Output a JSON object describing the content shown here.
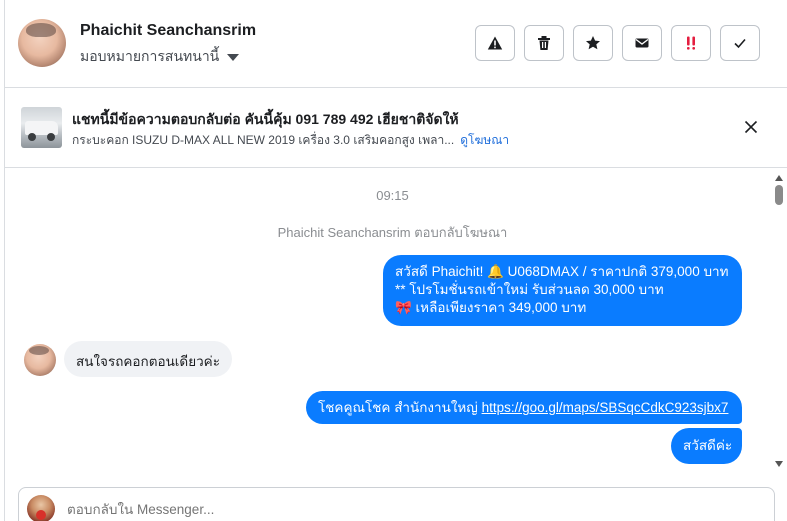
{
  "header": {
    "name": "Phaichit Seanchansrim",
    "assign_label": "มอบหมายการสนทนานี้",
    "actions": [
      {
        "name": "report-button",
        "icon": "warning-icon"
      },
      {
        "name": "delete-button",
        "icon": "trash-icon"
      },
      {
        "name": "star-button",
        "icon": "star-icon"
      },
      {
        "name": "mark-unread-button",
        "icon": "envelope-icon"
      },
      {
        "name": "follow-up-button",
        "icon": "double-exclamation-icon"
      },
      {
        "name": "mark-done-button",
        "icon": "checkmark-icon"
      }
    ]
  },
  "ad": {
    "title": "แชทนี้มีข้อความตอบกลับต่อ คันนี้คุ้ม 091 789 492 เฮียชาติจัดให้",
    "description": "กระบะคอก ISUZU D-MAX ALL NEW 2019 เครื่อง 3.0 เสริมคอกสูง เพลา...",
    "link_label": "ดูโฆษณา"
  },
  "conversation": {
    "timestamp": "09:15",
    "system_message": "Phaichit Seanchansrim ตอบกลับโฆษณา",
    "outgoing_1": {
      "line1": "สวัสดี Phaichit! 🔔 U068DMAX / ราคาปกติ 379,000 บาท",
      "line2": "** โปรโมชั่นรถเข้าใหม่ รับส่วนลด 30,000 บาท",
      "line3": "🎀 เหลือเพียงราคา 349,000 บาท"
    },
    "incoming_1": "สนใจรถคอกตอนเดียวค่ะ",
    "outgoing_2": {
      "prefix": "โชคคูณโชค สำนักงานใหญ่ ",
      "link": "https://goo.gl/maps/SBSqcCdkC923sjbx7"
    },
    "outgoing_3": "สวัสดีค่ะ"
  },
  "composer": {
    "placeholder": "ตอบกลับใน Messenger..."
  },
  "colors": {
    "outgoing_bubble": "#0a7cff",
    "incoming_bubble": "#f0f2f5",
    "link": "#216fdb",
    "follow_up_icon": "#e41e3f"
  }
}
